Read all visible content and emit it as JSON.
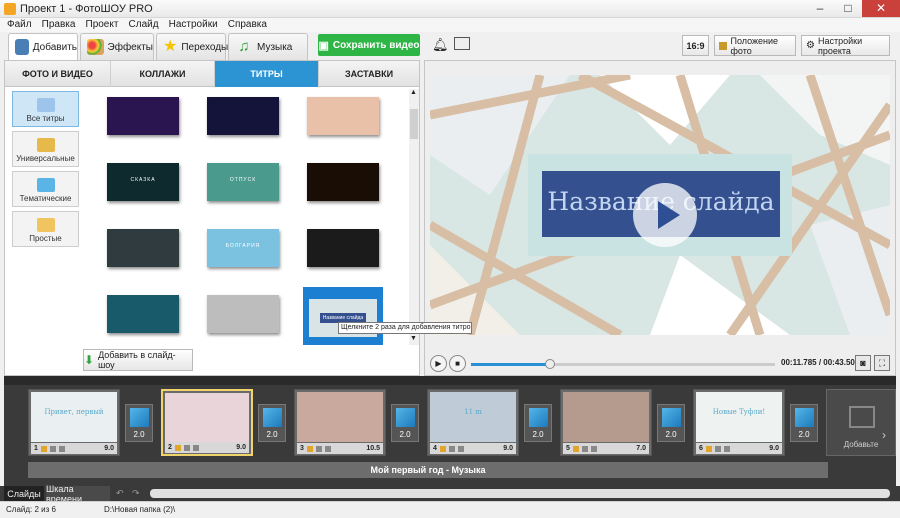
{
  "window": {
    "title": "Проект 1 - ФотоШОУ PRO",
    "minimize": "–",
    "maximize": "□",
    "close": "✕"
  },
  "menu": [
    "Файл",
    "Правка",
    "Проект",
    "Слайд",
    "Настройки",
    "Справка"
  ],
  "tabs": [
    {
      "label": "Добавить",
      "icon": "add-photo-icon"
    },
    {
      "label": "Эффекты",
      "icon": "palette-icon"
    },
    {
      "label": "Переходы",
      "icon": "star-icon"
    },
    {
      "label": "Музыка",
      "icon": "music-note-icon"
    }
  ],
  "toolbar": {
    "save_label": "Сохранить видео",
    "ratio": "16:9",
    "photo_position": "Положение фото",
    "project_settings": "Настройки проекта"
  },
  "subtabs": [
    "ФОТО И ВИДЕО",
    "КОЛЛАЖИ",
    "ТИТРЫ",
    "ЗАСТАВКИ"
  ],
  "categories": [
    {
      "label": "Все титры",
      "icon": "abc-icon"
    },
    {
      "label": "Универсальные",
      "icon": "monitor-icon"
    },
    {
      "label": "Тематические",
      "icon": "gift-icon"
    },
    {
      "label": "Простые",
      "icon": "frame-icon"
    }
  ],
  "grid_thumbs": [
    {
      "text": "",
      "bg": "#2a1550"
    },
    {
      "text": "",
      "bg": "#14143a"
    },
    {
      "text": "",
      "bg": "#e9c1a8"
    },
    {
      "text": "СКАЗКА",
      "bg": "#0f2a2e"
    },
    {
      "text": "ОТПУСК",
      "bg": "#4a9a8e"
    },
    {
      "text": "",
      "bg": "#1a0d05"
    },
    {
      "text": "",
      "bg": "#2f3b3e"
    },
    {
      "text": "БОЛГАРИЯ",
      "bg": "#7ac2e0"
    },
    {
      "text": "",
      "bg": "#1b1b1b"
    },
    {
      "text": "",
      "bg": "#185a6a"
    },
    {
      "text": "",
      "bg": "#bdbdbd"
    },
    {
      "text": "Название слайда",
      "bg": "#d9e4e6"
    }
  ],
  "tooltip": "Щелкните 2 раза для добавления титров",
  "add_to_show": "Добавить в слайд-шоу",
  "preview": {
    "title": "Название слайда",
    "colors": {
      "bg": "#d9e7e6",
      "band": "#2f4f94",
      "line": "#d8b79d"
    }
  },
  "player": {
    "time": "00:11.785 / 00:43.500",
    "progress": 0.26
  },
  "slides": [
    {
      "num": "1",
      "dur": "9.0",
      "trans": "2.0",
      "bg": "#eaf0f2",
      "label": "Привет, первый"
    },
    {
      "num": "2",
      "dur": "9.0",
      "trans": "2.0",
      "bg": "#e9d4d9",
      "label": ""
    },
    {
      "num": "3",
      "dur": "10.5",
      "trans": "2.0",
      "bg": "#c9a89e",
      "label": ""
    },
    {
      "num": "4",
      "dur": "9.0",
      "trans": "2.0",
      "bg": "#bfcbd6",
      "label": "11 m"
    },
    {
      "num": "5",
      "dur": "7.0",
      "trans": "2.0",
      "bg": "#b59b8e",
      "label": ""
    },
    {
      "num": "6",
      "dur": "9.0",
      "trans": "2.0",
      "bg": "#eef3f2",
      "label": "Новые Туфли!"
    }
  ],
  "add_slide": "Добавьте",
  "music_track": "Мой первый год - Музыка",
  "bottom_tabs": [
    "Слайды",
    "Шкала времени"
  ],
  "status": {
    "slide": "Слайд: 2 из 6",
    "path": "D:\\Новая папка (2)\\"
  }
}
